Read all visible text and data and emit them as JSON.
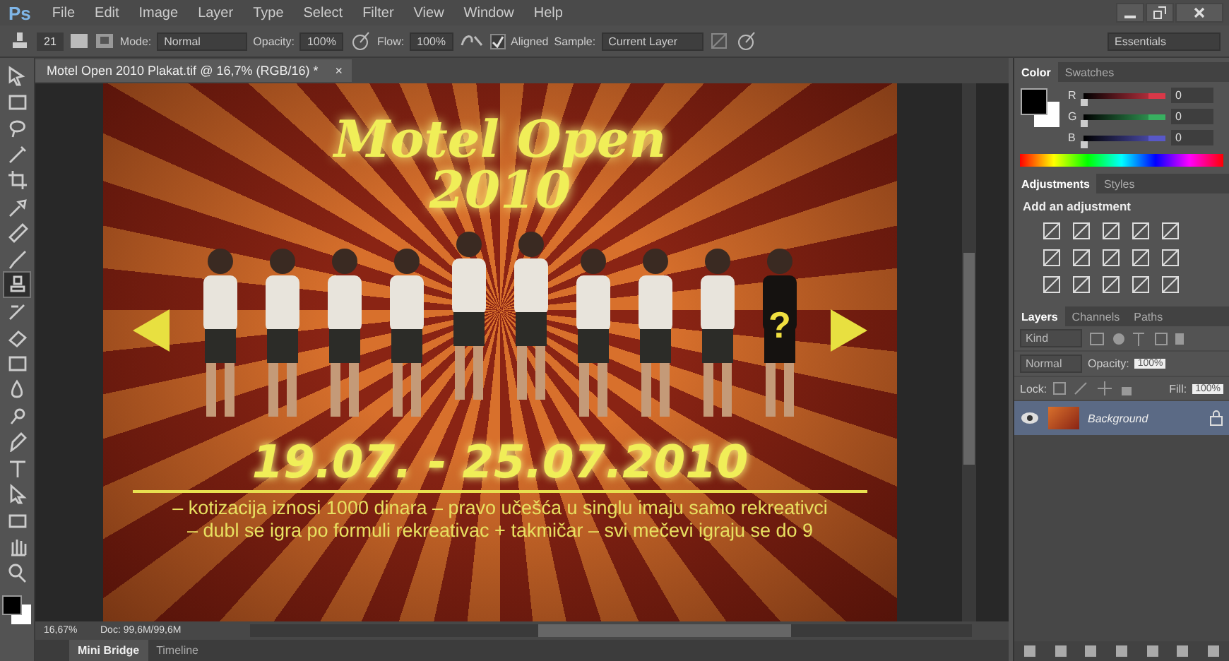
{
  "app": {
    "logo": "Ps"
  },
  "menu": [
    "File",
    "Edit",
    "Image",
    "Layer",
    "Type",
    "Select",
    "Filter",
    "View",
    "Window",
    "Help"
  ],
  "options": {
    "brush_size": "21",
    "mode_label": "Mode:",
    "mode": "Normal",
    "opacity_label": "Opacity:",
    "opacity": "100%",
    "flow_label": "Flow:",
    "flow": "100%",
    "aligned": {
      "label": "Aligned",
      "checked": true
    },
    "sample_label": "Sample:",
    "sample": "Current Layer",
    "workspace": "Essentials"
  },
  "document_tab": {
    "title": "Motel Open 2010 Plakat.tif @ 16,7% (RGB/16) *",
    "close": "×"
  },
  "tools": [
    {
      "selected": false
    },
    {
      "selected": false
    },
    {
      "selected": false
    },
    {
      "selected": false
    },
    {
      "selected": false
    },
    {
      "selected": false
    },
    {
      "selected": false
    },
    {
      "selected": false
    },
    {
      "selected": true
    },
    {
      "selected": false
    },
    {
      "selected": false
    },
    {
      "selected": false
    },
    {
      "selected": false
    },
    {
      "selected": false
    },
    {
      "selected": false
    },
    {
      "selected": false
    },
    {
      "selected": false
    },
    {
      "selected": false
    },
    {
      "selected": false
    },
    {
      "selected": false
    }
  ],
  "poster": {
    "title": "Motel Open",
    "year": "2010",
    "mystery_mark": "?",
    "dates": "19.07. - 25.07.2010",
    "lines": [
      "– kotizacija iznosi 1000 dinara – pravo učešća u singlu imaju samo rekreativci",
      "– dubl se igra po formuli rekreativac + takmičar – svi mečevi igraju se do 9"
    ]
  },
  "status_bar": {
    "zoom": "16,67%",
    "doc": "Doc: 99,6M/99,6M"
  },
  "bottom_tabs": [
    {
      "label": "Mini Bridge",
      "selected": true
    },
    {
      "label": "Timeline",
      "selected": false
    }
  ],
  "color_panel": {
    "tabs": [
      {
        "label": "Color",
        "selected": true
      },
      {
        "label": "Swatches",
        "selected": false
      }
    ],
    "channels": [
      {
        "name": "R",
        "value": "0",
        "level": 0,
        "color": "#d83848"
      },
      {
        "name": "G",
        "value": "0",
        "level": 0,
        "color": "#38b060"
      },
      {
        "name": "B",
        "value": "0",
        "level": 0,
        "color": "#5858c8"
      }
    ]
  },
  "adjustments_panel": {
    "tabs": [
      {
        "label": "Adjustments",
        "selected": true
      },
      {
        "label": "Styles",
        "selected": false
      }
    ],
    "heading": "Add an adjustment"
  },
  "layers_panel": {
    "tabs": [
      {
        "label": "Layers",
        "selected": true
      },
      {
        "label": "Channels",
        "selected": false
      },
      {
        "label": "Paths",
        "selected": false
      }
    ],
    "filter": "Kind",
    "blend_mode": "Normal",
    "opacity_label": "Opacity:",
    "opacity": "100%",
    "lock_label": "Lock:",
    "fill_label": "Fill:",
    "fill": "100%",
    "layers": [
      {
        "name": "Background",
        "selected": true,
        "visible": true,
        "locked": true
      }
    ]
  }
}
